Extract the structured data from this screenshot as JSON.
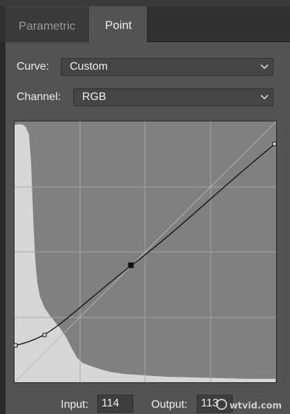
{
  "tabs": [
    {
      "label": "Parametric"
    },
    {
      "label": "Point"
    }
  ],
  "curve": {
    "label": "Curve:",
    "value": "Custom",
    "chevron_icon": "chevron-down-icon"
  },
  "channel": {
    "label": "Channel:",
    "value": "RGB",
    "chevron_icon": "chevron-down-icon"
  },
  "point_editor": {
    "input_label": "Input:",
    "input_value": "114",
    "output_label": "Output:",
    "output_value": "113"
  },
  "watermark": "wtvid.com",
  "colors": {
    "panel": "#535353",
    "histogram": "#d6d6d6",
    "plot_background": "#808080",
    "curve_line": "#111111",
    "grid": "#a6a6a6"
  }
}
